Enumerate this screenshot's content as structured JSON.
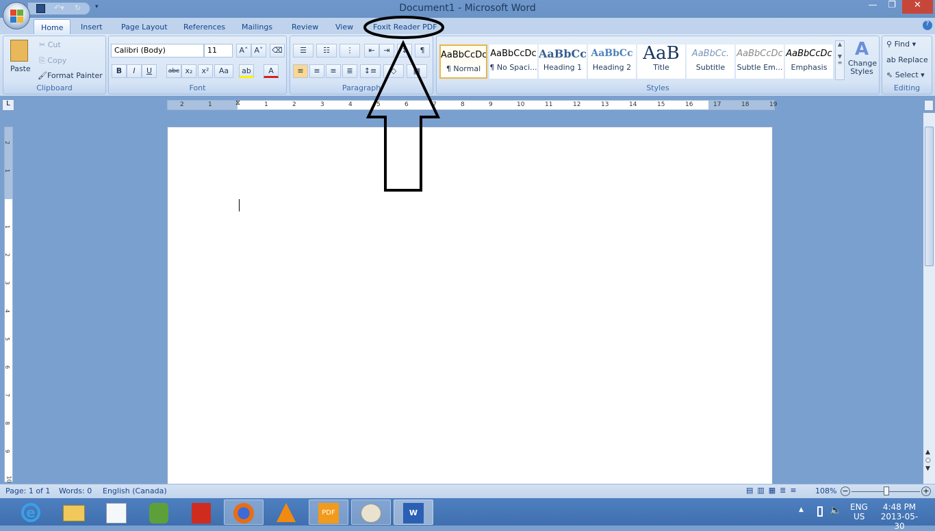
{
  "window": {
    "title": "Document1 - Microsoft Word",
    "minimize": "—",
    "restore": "❐",
    "close": "✕"
  },
  "tabs": [
    "Home",
    "Insert",
    "Page Layout",
    "References",
    "Mailings",
    "Review",
    "View",
    "Foxit Reader PDF"
  ],
  "clipboard": {
    "paste": "Paste",
    "cut": "Cut",
    "copy": "Copy",
    "format_painter": "Format Painter",
    "label": "Clipboard"
  },
  "font": {
    "name": "Calibri (Body)",
    "size": "11",
    "label": "Font",
    "bold": "B",
    "italic": "I",
    "underline": "U",
    "strike": "abc",
    "sub": "x₂",
    "sup": "x²",
    "case": "Aa",
    "grow": "A˄",
    "shrink": "A˅",
    "color": "A",
    "highlight": "ab"
  },
  "paragraph": {
    "label": "Paragraph",
    "pilcrow": "¶"
  },
  "styles": {
    "label": "Styles",
    "items": [
      {
        "preview": "AaBbCcDc",
        "name": "¶ Normal"
      },
      {
        "preview": "AaBbCcDc",
        "name": "¶ No Spaci..."
      },
      {
        "preview": "AaBbCc",
        "name": "Heading 1"
      },
      {
        "preview": "AaBbCc",
        "name": "Heading 2"
      },
      {
        "preview": "AaB",
        "name": "Title"
      },
      {
        "preview": "AaBbCc.",
        "name": "Subtitle"
      },
      {
        "preview": "AaBbCcDc",
        "name": "Subtle Em..."
      },
      {
        "preview": "AaBbCcDc",
        "name": "Emphasis"
      }
    ],
    "change_styles": "Change Styles"
  },
  "editing": {
    "label": "Editing",
    "find": "Find",
    "replace": "Replace",
    "select": "Select"
  },
  "ruler": {
    "h": [
      "2",
      "1",
      "1",
      "2",
      "3",
      "4",
      "5",
      "6",
      "7",
      "8",
      "9",
      "10",
      "11",
      "12",
      "13",
      "14",
      "15",
      "16",
      "17",
      "18",
      "19"
    ],
    "v": [
      "2",
      "1",
      "1",
      "2",
      "3",
      "4",
      "5",
      "6",
      "7",
      "8",
      "9",
      "10"
    ]
  },
  "status": {
    "page": "Page: 1 of 1",
    "words": "Words: 0",
    "language": "English (Canada)",
    "zoom": "108%",
    "zoom_value": 108
  },
  "tray": {
    "lang": "ENG",
    "region": "US",
    "time": "4:48 PM",
    "date": "2013-05-30"
  },
  "taskbar": [
    "internet-explorer",
    "file-explorer",
    "word-document-app",
    "evernote",
    "adobe-reader",
    "firefox",
    "vlc",
    "foxit-reader",
    "paint",
    "microsoft-word"
  ],
  "annotation_color": "#000000"
}
